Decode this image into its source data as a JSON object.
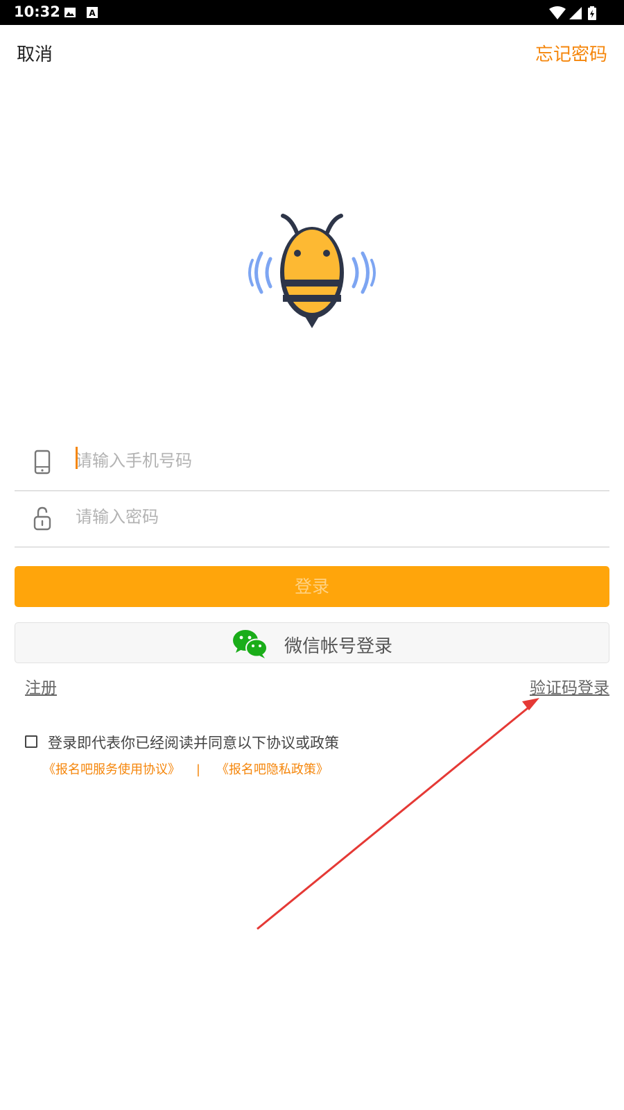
{
  "status_bar": {
    "time": "10:32"
  },
  "top_bar": {
    "cancel_label": "取消",
    "forgot_label": "忘记密码"
  },
  "phone_field": {
    "placeholder": "请输入手机号码"
  },
  "password_field": {
    "placeholder": "请输入密码"
  },
  "login_button": {
    "label": "登录"
  },
  "wechat_button": {
    "label": "微信帐号登录"
  },
  "links": {
    "register": "注册",
    "code_login": "验证码登录"
  },
  "agreement": {
    "text": "登录即代表你已经阅读并同意以下协议或政策",
    "service_agreement": "《报名吧服务使用协议》",
    "separator": "|",
    "privacy_policy": "《报名吧隐私政策》"
  },
  "colors": {
    "accent": "#f5860b",
    "button": "#ffa50b",
    "arrow": "#e53935",
    "wechat": "#1aad19"
  }
}
